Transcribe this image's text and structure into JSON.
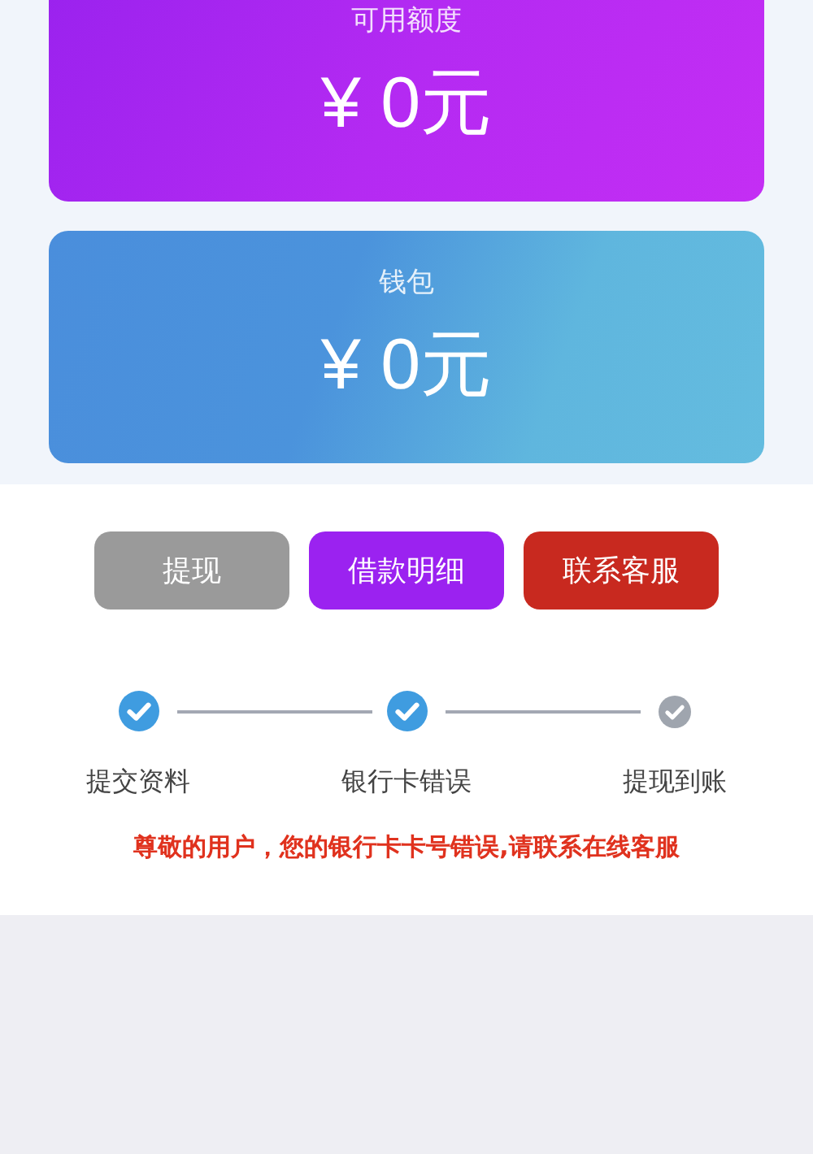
{
  "cards": [
    {
      "kind": "credit",
      "label": "可用额度",
      "amount": "¥ 0元"
    },
    {
      "kind": "wallet",
      "label": "钱包",
      "amount": "¥ 0元"
    }
  ],
  "buttons": [
    {
      "kind": "neutral",
      "label": "提现"
    },
    {
      "kind": "primary",
      "label": "借款明细"
    },
    {
      "kind": "danger",
      "label": "联系客服"
    }
  ],
  "steps": [
    {
      "label": "提交资料",
      "done": true
    },
    {
      "label": "银行卡错误",
      "done": true
    },
    {
      "label": "提现到账",
      "done": false
    }
  ],
  "notice": "尊敬的用户，您的银行卡卡号错误,请联系在线客服"
}
